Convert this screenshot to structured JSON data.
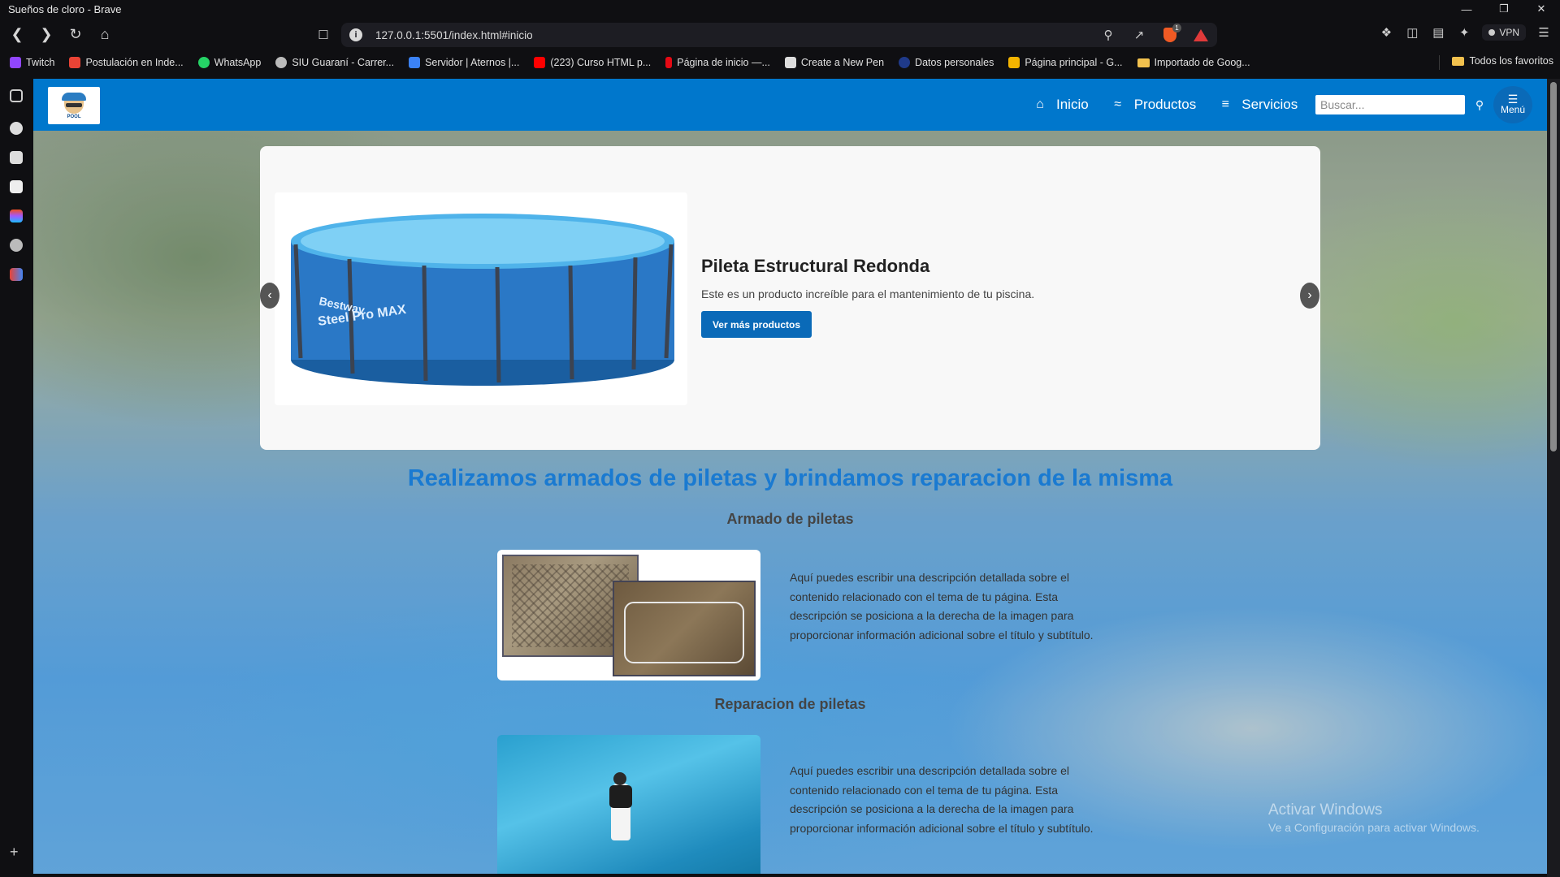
{
  "browser": {
    "window_title": "Sueños de cloro - Brave",
    "url": "127.0.0.1:5501/index.html#inicio",
    "brave_badge": "1",
    "vpn_label": "VPN",
    "bookmarks": [
      {
        "label": "Twitch",
        "color": "#9146ff"
      },
      {
        "label": "Postulación en Inde...",
        "color": "#ea4335"
      },
      {
        "label": "WhatsApp",
        "color": "#25d366"
      },
      {
        "label": "SIU Guaraní - Carrer...",
        "color": "#bbbbbb"
      },
      {
        "label": "Servidor | Aternos |...",
        "color": "#3b82f6"
      },
      {
        "label": "(223) Curso HTML p...",
        "color": "#ff0000"
      },
      {
        "label": "Página de inicio —...",
        "color": "#e50914"
      },
      {
        "label": "Create a New Pen",
        "color": "#dddddd"
      },
      {
        "label": "Datos personales",
        "color": "#1f3a8a"
      },
      {
        "label": "Página principal - G...",
        "color": "#f4b400"
      },
      {
        "label": "Importado de Goog...",
        "color": "#f2c14e"
      }
    ],
    "bookmarks_all": "Todos los favoritos"
  },
  "site": {
    "logo_text": "POOL",
    "nav": [
      {
        "label": "Inicio",
        "icon": "home-icon"
      },
      {
        "label": "Productos",
        "icon": "swimmer-icon"
      },
      {
        "label": "Servicios",
        "icon": "water-icon"
      }
    ],
    "search_placeholder": "Buscar...",
    "menu_label": "Menú"
  },
  "slider": {
    "title": "Pileta Estructural Redonda",
    "description": "Este es un producto increíble para el mantenimiento de tu piscina.",
    "button": "Ver más productos",
    "pool_brand": "Bestway",
    "pool_model": "Steel Pro MAX"
  },
  "main": {
    "heading": "Realizamos armados de piletas y brindamos reparacion de la misma",
    "section1_title": "Armado de piletas",
    "section1_text": "Aquí puedes escribir una descripción detallada sobre el contenido relacionado con el tema de tu página. Esta descripción se posiciona a la derecha de la imagen para proporcionar información adicional sobre el título y subtítulo.",
    "section2_title": "Reparacion de piletas",
    "section2_text": "Aquí puedes escribir una descripción detallada sobre el contenido relacionado con el tema de tu página. Esta descripción se posiciona a la derecha de la imagen para proporcionar información adicional sobre el título y subtítulo."
  },
  "watermark": {
    "line1": "Activar Windows",
    "line2": "Ve a Configuración para activar Windows."
  },
  "colors": {
    "nav_bg": "#0077cc",
    "accent": "#0a6ab8",
    "heading": "#1a7ad1"
  }
}
